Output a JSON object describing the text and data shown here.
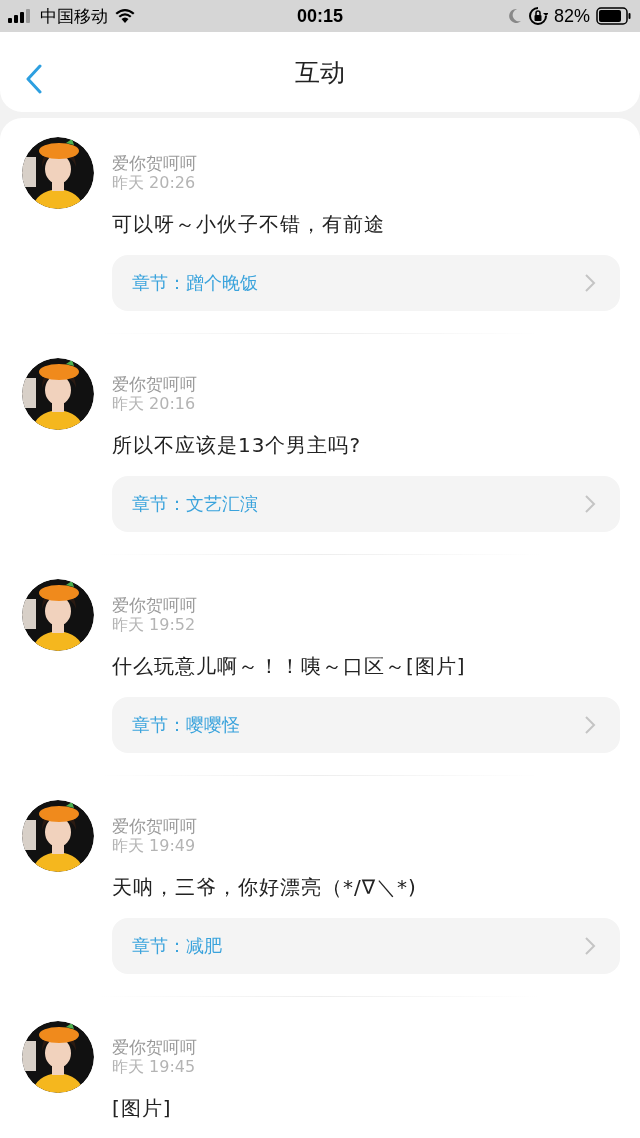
{
  "status_bar": {
    "carrier": "中国移动",
    "time": "00:15",
    "battery": "82%"
  },
  "header": {
    "title": "互动"
  },
  "comments": [
    {
      "kind": "picture",
      "user": "爱你贺呵呵",
      "time": "昨天 20:26",
      "text": "可以呀～小伙子不错，有前途",
      "chapter": "章节：蹭个晚饭"
    },
    {
      "kind": "picture",
      "user": "爱你贺呵呵",
      "time": "昨天 20:16",
      "text": "所以不应该是13个男主吗?",
      "chapter": "章节：文艺汇演"
    },
    {
      "kind": "picture",
      "user": "爱你贺呵呵",
      "time": "昨天 19:52",
      "text": "什么玩意儿啊～！！咦～口区～[图片]",
      "chapter": "章节：嘤嘤怪"
    },
    {
      "kind": "picture",
      "user": "爱你贺呵呵",
      "time": "昨天 19:49",
      "text": "天呐，三爷，你好漂亮（*/∇＼*)",
      "chapter": "章节：减肥"
    },
    {
      "kind": "picture",
      "user": "爱你贺呵呵",
      "time": "昨天 19:45",
      "text": "[图片]"
    }
  ]
}
